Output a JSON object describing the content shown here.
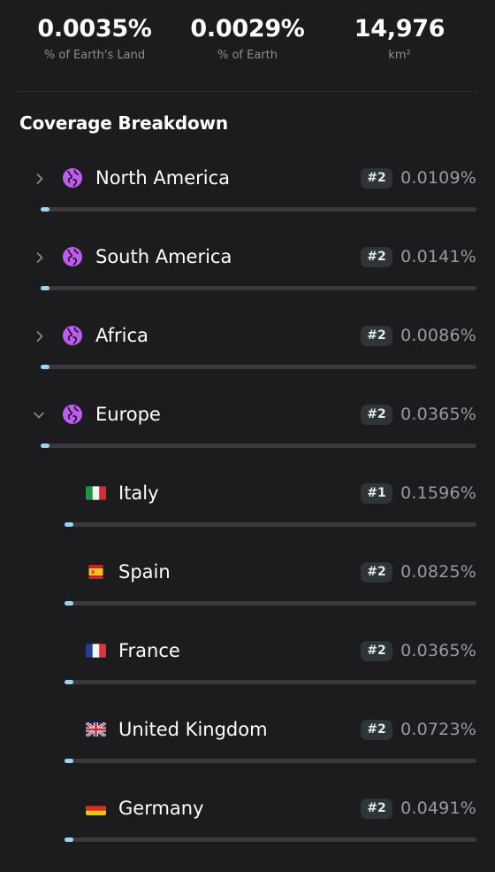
{
  "stats": [
    {
      "value": "0.0035%",
      "label": "% of Earth's Land"
    },
    {
      "value": "0.0029%",
      "label": "% of Earth"
    },
    {
      "value": "14,976",
      "label": "km²"
    }
  ],
  "breakdown": {
    "title": "Coverage Breakdown",
    "continents": [
      {
        "name": "North America",
        "rank": "#2",
        "percent": "0.0109%",
        "expanded": false,
        "bar_fraction": 0.0109
      },
      {
        "name": "South America",
        "rank": "#2",
        "percent": "0.0141%",
        "expanded": false,
        "bar_fraction": 0.0141
      },
      {
        "name": "Africa",
        "rank": "#2",
        "percent": "0.0086%",
        "expanded": false,
        "bar_fraction": 0.0086
      },
      {
        "name": "Europe",
        "rank": "#2",
        "percent": "0.0365%",
        "expanded": true,
        "bar_fraction": 0.0365,
        "countries": [
          {
            "name": "Italy",
            "flag": "italy-flag-icon",
            "rank": "#1",
            "percent": "0.1596%",
            "bar_fraction": 0.1596
          },
          {
            "name": "Spain",
            "flag": "spain-flag-icon",
            "rank": "#2",
            "percent": "0.0825%",
            "bar_fraction": 0.0825
          },
          {
            "name": "France",
            "flag": "france-flag-icon",
            "rank": "#2",
            "percent": "0.0365%",
            "bar_fraction": 0.0365
          },
          {
            "name": "United Kingdom",
            "flag": "united-kingdom-flag-icon",
            "rank": "#2",
            "percent": "0.0723%",
            "bar_fraction": 0.0723
          },
          {
            "name": "Germany",
            "flag": "germany-flag-icon",
            "rank": "#2",
            "percent": "0.0491%",
            "bar_fraction": 0.0491
          }
        ]
      }
    ]
  },
  "colors": {
    "background": "#1c1c1e",
    "globe": "#bf5af2",
    "bar_fill": "#9fd3f2",
    "bar_track": "#3a3a3d",
    "rank_badge": "#2e3539"
  }
}
